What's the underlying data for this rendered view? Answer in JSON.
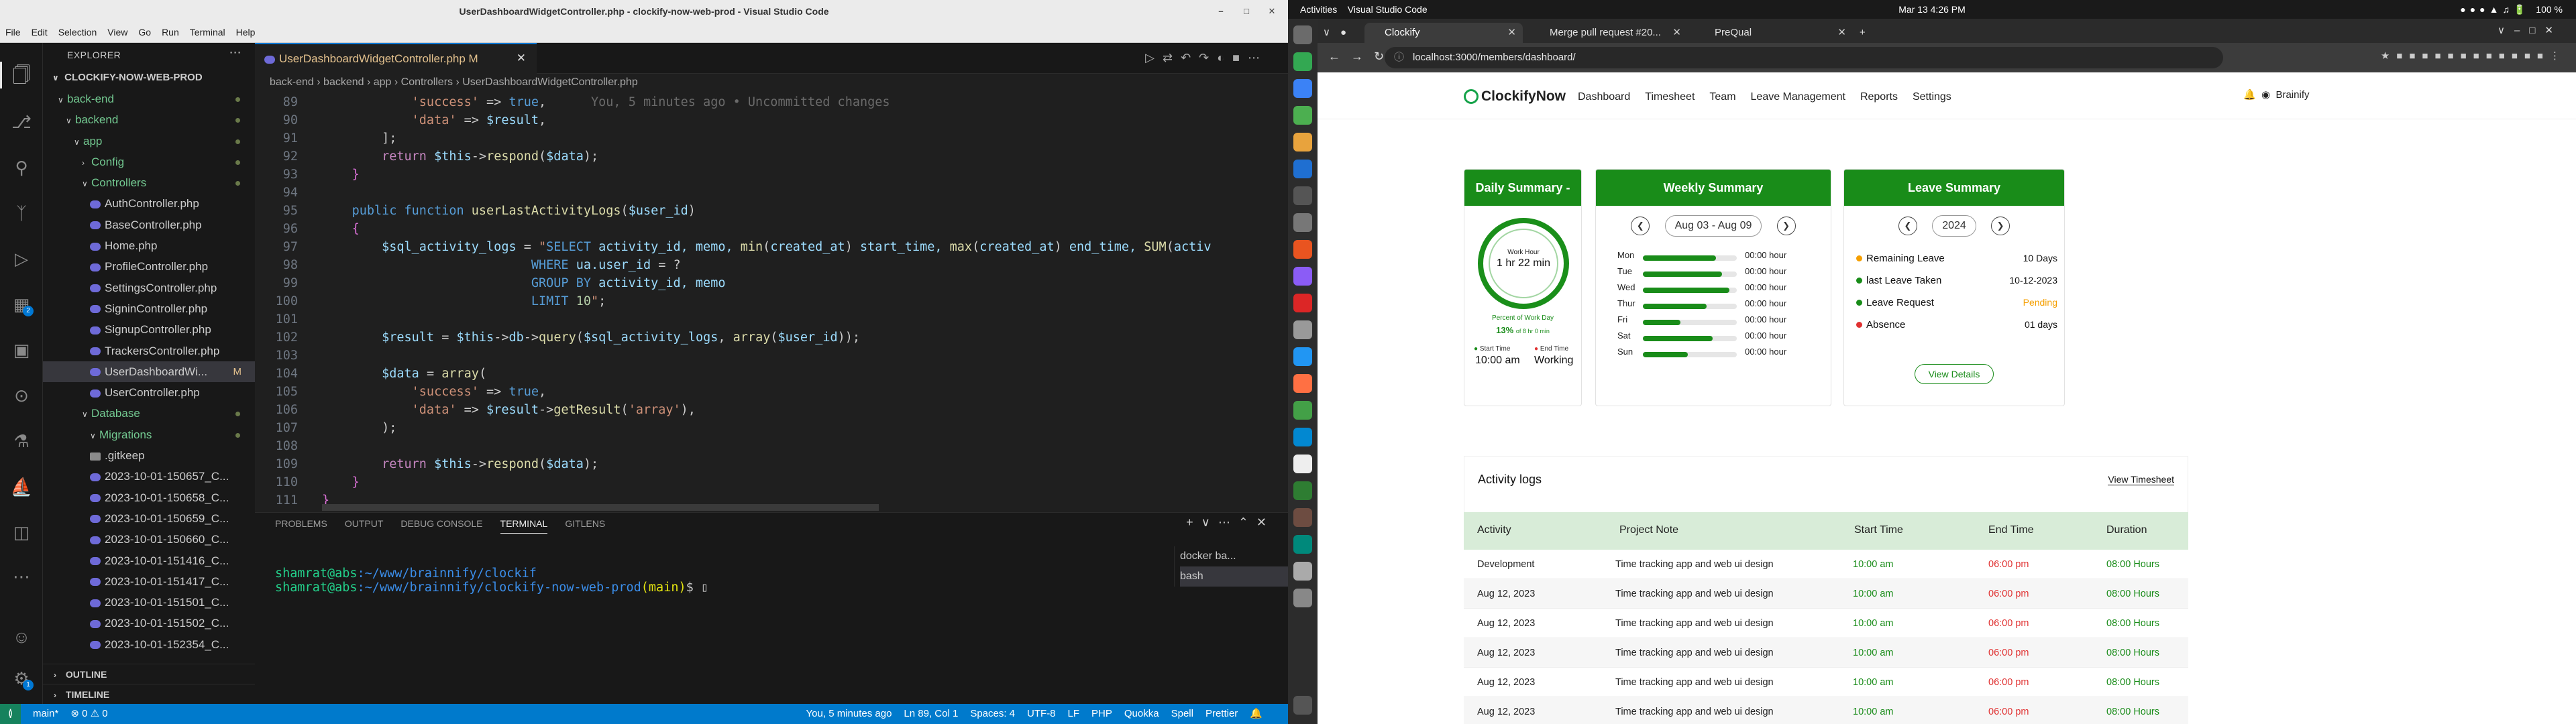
{
  "vscode": {
    "title": "UserDashboardWidgetController.php - clockify-now-web-prod - Visual Studio Code",
    "menu": [
      "File",
      "Edit",
      "Selection",
      "View",
      "Go",
      "Run",
      "Terminal",
      "Help"
    ],
    "explorer_label": "EXPLORER",
    "root_folder": "CLOCKIFY-NOW-WEB-PROD",
    "tree": [
      {
        "label": "back-end",
        "indent": 1,
        "type": "folder",
        "open": true
      },
      {
        "label": "backend",
        "indent": 2,
        "type": "folder",
        "open": true
      },
      {
        "label": "app",
        "indent": 3,
        "type": "folder",
        "open": true
      },
      {
        "label": "Config",
        "indent": 4,
        "type": "folder",
        "open": false
      },
      {
        "label": "Controllers",
        "indent": 4,
        "type": "folder",
        "open": true
      },
      {
        "label": "AuthController.php",
        "indent": 5,
        "type": "php"
      },
      {
        "label": "BaseController.php",
        "indent": 5,
        "type": "php"
      },
      {
        "label": "Home.php",
        "indent": 5,
        "type": "php"
      },
      {
        "label": "ProfileController.php",
        "indent": 5,
        "type": "php"
      },
      {
        "label": "SettingsController.php",
        "indent": 5,
        "type": "php"
      },
      {
        "label": "SigninController.php",
        "indent": 5,
        "type": "php"
      },
      {
        "label": "SignupController.php",
        "indent": 5,
        "type": "php"
      },
      {
        "label": "TrackersController.php",
        "indent": 5,
        "type": "php"
      },
      {
        "label": "UserDashboardWi...",
        "indent": 5,
        "type": "php",
        "selected": true,
        "mark": "M"
      },
      {
        "label": "UserController.php",
        "indent": 5,
        "type": "php"
      },
      {
        "label": "Database",
        "indent": 4,
        "type": "folder",
        "open": true
      },
      {
        "label": "Migrations",
        "indent": 5,
        "type": "folder",
        "open": true
      },
      {
        "label": ".gitkeep",
        "indent": 5,
        "type": "gitkeep"
      },
      {
        "label": "2023-10-01-150657_C...",
        "indent": 5,
        "type": "php"
      },
      {
        "label": "2023-10-01-150658_C...",
        "indent": 5,
        "type": "php"
      },
      {
        "label": "2023-10-01-150659_C...",
        "indent": 5,
        "type": "php"
      },
      {
        "label": "2023-10-01-150660_C...",
        "indent": 5,
        "type": "php"
      },
      {
        "label": "2023-10-01-151416_C...",
        "indent": 5,
        "type": "php"
      },
      {
        "label": "2023-10-01-151417_C...",
        "indent": 5,
        "type": "php"
      },
      {
        "label": "2023-10-01-151501_C...",
        "indent": 5,
        "type": "php"
      },
      {
        "label": "2023-10-01-151502_C...",
        "indent": 5,
        "type": "php"
      },
      {
        "label": "2023-10-01-152354_C...",
        "indent": 5,
        "type": "php"
      }
    ],
    "outline": "OUTLINE",
    "timeline": "TIMELINE",
    "tab_label": "UserDashboardWidgetController.php",
    "tab_mark": "M",
    "breadcrumb": "back-end › backend › app › Controllers › UserDashboardWidgetController.php",
    "blame": "You, 5 minutes ago • Uncommitted changes",
    "panel_tabs": [
      "PROBLEMS",
      "OUTPUT",
      "DEBUG CONSOLE",
      "TERMINAL",
      "GITLENS"
    ],
    "terminal_line1_user": "shamrat@abs",
    "terminal_line1_path": ":~/www/brainnify/clockif",
    "terminal_line2_user": "shamrat@abs",
    "terminal_line2_path": ":~/www/brainnify/clockify-now-web-prod",
    "terminal_line2_branch": "(main)",
    "terminal_prompt": "$",
    "terminal_list": [
      "docker ba...",
      "bash"
    ],
    "status": {
      "branch": "main*",
      "errors": "⊗ 0 ⚠ 0",
      "blame": "You, 5 minutes ago",
      "cursor": "Ln 89, Col 1",
      "spaces": "Spaces: 4",
      "encoding": "UTF-8",
      "eol": "LF",
      "lang": "PHP",
      "items": [
        "Quokka",
        "Spell",
        "Prettier"
      ]
    }
  },
  "ubuntu": {
    "activities": "Activities",
    "app": "Visual Studio Code",
    "clock": "Mar 13  4:26 PM",
    "battery": "100 %"
  },
  "chrome": {
    "tabs": [
      "Clockify",
      "Merge pull request #20...",
      "PreQual"
    ],
    "url": "localhost:3000/members/dashboard/"
  },
  "app": {
    "logo": "ClockifyNow",
    "menu": [
      "Dashboard",
      "Timesheet",
      "Team",
      "Leave Management",
      "Reports",
      "Settings"
    ],
    "user": "Brainify",
    "daily": {
      "title": "Daily Summary - Today",
      "work_label": "Work Hour",
      "work_time": "1 hr 22 min",
      "pct_label": "Percent of Work Day",
      "pct": "13%",
      "pct_sub": "of 8 hr 0 min",
      "start_label": "Start Time",
      "start": "10:00 am",
      "end_label": "End Time",
      "end": "Working"
    },
    "weekly": {
      "title": "Weekly Summary",
      "range": "Aug 03 - Aug 09",
      "days": [
        {
          "d": "Mon",
          "h": "00:00 hour",
          "v": 0.78
        },
        {
          "d": "Tue",
          "h": "00:00 hour",
          "v": 0.84
        },
        {
          "d": "Wed",
          "h": "00:00 hour",
          "v": 0.92
        },
        {
          "d": "Thur",
          "h": "00:00 hour",
          "v": 0.68
        },
        {
          "d": "Fri",
          "h": "00:00 hour",
          "v": 0.4
        },
        {
          "d": "Sat",
          "h": "00:00 hour",
          "v": 0.74
        },
        {
          "d": "Sun",
          "h": "00:00 hour",
          "v": 0.48
        }
      ]
    },
    "leave": {
      "title": "Leave Summary",
      "year": "2024",
      "rows": [
        {
          "label": "Remaining Leave",
          "value": "10 Days",
          "color": "#f59f00",
          "vcolor": "#111"
        },
        {
          "label": "last Leave Taken",
          "value": "10-12-2023",
          "color": "#198c19",
          "vcolor": "#111"
        },
        {
          "label": "Leave Request",
          "value": "Pending",
          "color": "#198c19",
          "vcolor": "#f59f00"
        },
        {
          "label": "Absence",
          "value": "01 days",
          "color": "#e03131",
          "vcolor": "#111"
        }
      ],
      "button": "View Details"
    },
    "activity": {
      "title": "Activity logs",
      "link": "View Timesheet",
      "headers": [
        "Activity",
        "Project Note",
        "Start Time",
        "End Time",
        "Duration"
      ],
      "rows": [
        [
          "Development",
          "Time tracking app and web ui design",
          "10:00 am",
          "06:00 pm",
          "08:00 Hours"
        ],
        [
          "Aug 12, 2023",
          "Time tracking app and web ui design",
          "10:00 am",
          "06:00 pm",
          "08:00 Hours"
        ],
        [
          "Aug 12, 2023",
          "Time tracking app and web ui design",
          "10:00 am",
          "06:00 pm",
          "08:00 Hours"
        ],
        [
          "Aug 12, 2023",
          "Time tracking app and web ui design",
          "10:00 am",
          "06:00 pm",
          "08:00 Hours"
        ],
        [
          "Aug 12, 2023",
          "Time tracking app and web ui design",
          "10:00 am",
          "06:00 pm",
          "08:00 Hours"
        ],
        [
          "Aug 12, 2023",
          "Time tracking app and web ui design",
          "10:00 am",
          "06:00 pm",
          "08:00 Hours"
        ]
      ]
    }
  }
}
